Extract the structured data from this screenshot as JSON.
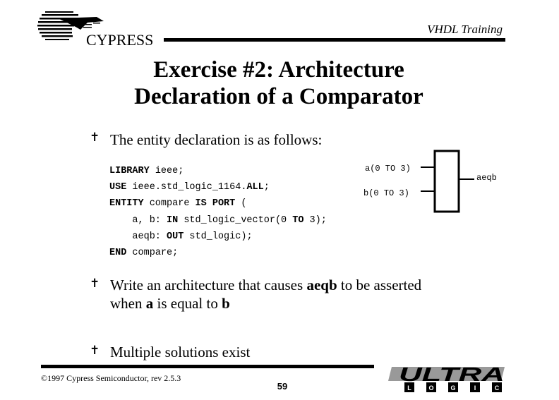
{
  "header": {
    "logo_text": "CYPRESS",
    "course_label": "VHDL Training"
  },
  "title": {
    "line1": "Exercise #2: Architecture",
    "line2": "Declaration of a Comparator"
  },
  "bullets": [
    {
      "icon": "bullet-icon",
      "text": "The entity declaration is as follows:"
    },
    {
      "icon": "bullet-icon",
      "parts": [
        "Write an architecture that causes ",
        "aeqb",
        " to be asserted",
        "when ",
        "a",
        " is equal to ",
        "b"
      ]
    },
    {
      "icon": "bullet-icon",
      "text": "Multiple solutions exist"
    }
  ],
  "code": {
    "lines": [
      [
        {
          "t": "LIBRARY",
          "b": true
        },
        {
          "t": " ieee;"
        }
      ],
      [
        {
          "t": "USE",
          "b": true
        },
        {
          "t": " ieee.std_logic_1164."
        },
        {
          "t": "ALL",
          "b": true
        },
        {
          "t": ";"
        }
      ],
      [
        {
          "t": "ENTITY",
          "b": true
        },
        {
          "t": " compare "
        },
        {
          "t": "IS",
          "b": true
        },
        {
          "t": " "
        },
        {
          "t": "PORT",
          "b": true
        },
        {
          "t": " ("
        }
      ],
      [
        {
          "t": "    a, b: "
        },
        {
          "t": "IN",
          "b": true
        },
        {
          "t": " std_logic_vector(0 "
        },
        {
          "t": "TO",
          "b": true
        },
        {
          "t": " 3);"
        }
      ],
      [
        {
          "t": "    aeqb: "
        },
        {
          "t": "OUT",
          "b": true
        },
        {
          "t": " std_logic);"
        }
      ],
      [
        {
          "t": "END",
          "b": true
        },
        {
          "t": " compare;"
        }
      ]
    ]
  },
  "diagram": {
    "input_a": "a(0 TO 3)",
    "input_b": "b(0 TO 3)",
    "output": "aeqb"
  },
  "footer": {
    "copyright": "©1997 Cypress Semiconductor, rev 2.5.3",
    "page_number": "59",
    "brand_top": "ULTRA",
    "brand_letters": [
      "L",
      "O",
      "G",
      "I",
      "C"
    ]
  }
}
